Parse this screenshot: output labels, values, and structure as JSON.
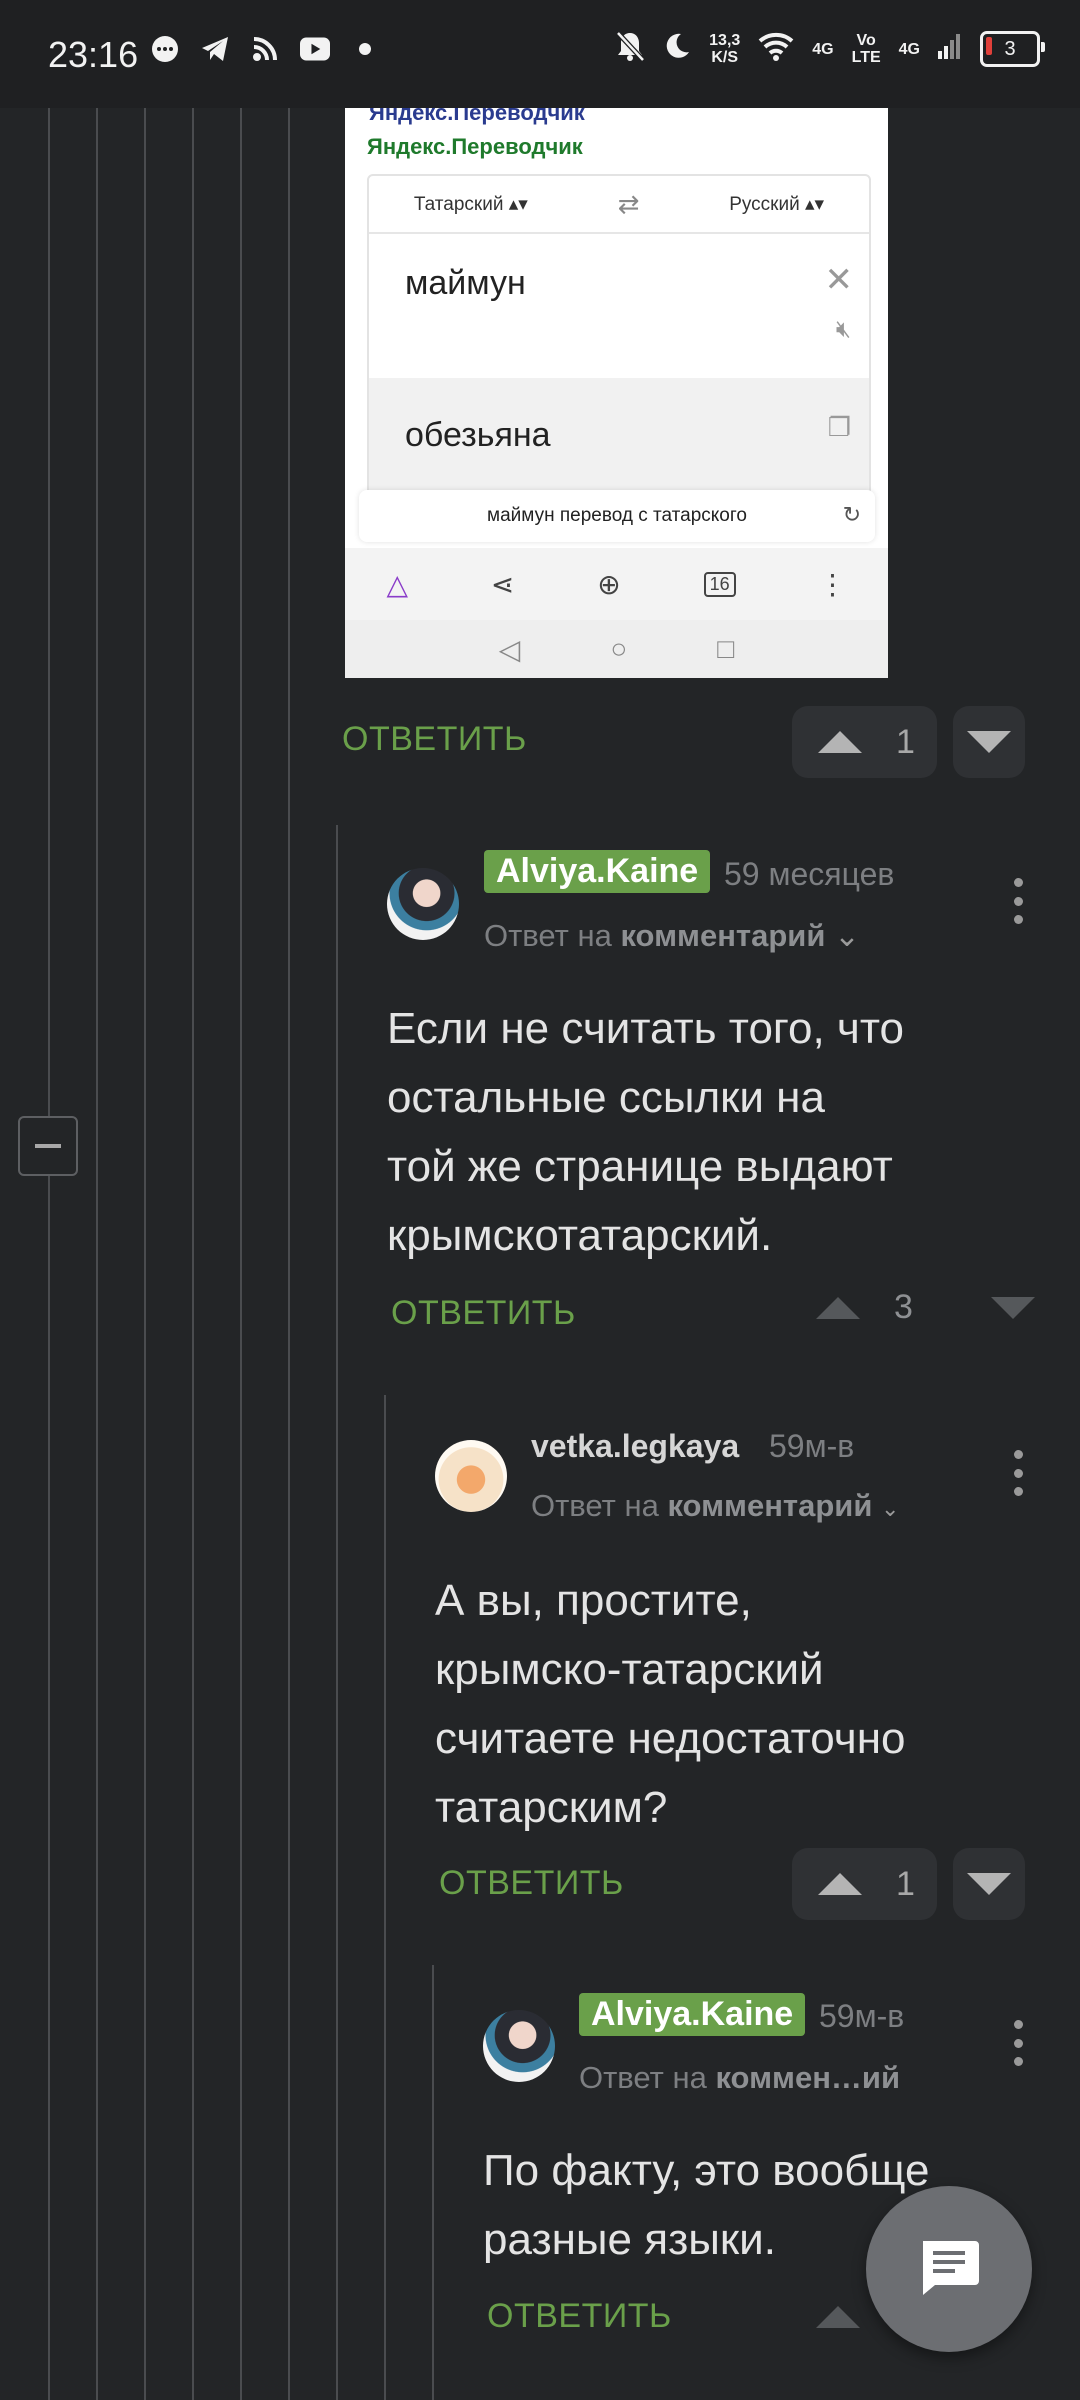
{
  "status_bar": {
    "time": "23:16",
    "net_speed_top": "13,3",
    "net_speed_bottom": "K/S",
    "lte_top": "Vo",
    "lte_bottom": "LTE",
    "signal1": "4G",
    "signal2": "4G",
    "battery": "3"
  },
  "image_screenshot": {
    "app_title_top": "Яндекс.Переводчик",
    "app_title": "Яндекс.Переводчик",
    "from_lang": "Татарский ▴▾",
    "to_lang": "Русский ▴▾",
    "source_text": "маймун",
    "translated_text": "обезьяна",
    "search_query": "маймун перевод с татарского",
    "tabs_count": "16"
  },
  "first_reply": {
    "reply_label": "ОТВЕТИТЬ",
    "votes": "1"
  },
  "comments": [
    {
      "username": "Alviya.Kaine",
      "time": "59 месяцев",
      "reply_prefix": "Ответ на",
      "reply_target": "комментарий",
      "text_lines": [
        "Если не считать того, что",
        "остальные ссылки на",
        "той же странице выдают",
        "крымскотатарский."
      ],
      "reply_label": "ОТВЕТИТЬ",
      "votes": "3"
    },
    {
      "username": "vetka.legkaya",
      "time": "59м-в",
      "reply_prefix": "Ответ на",
      "reply_target": "комментарий",
      "text_lines": [
        "А вы, простите,",
        "крымско-татарский",
        "считаете недостаточно",
        "татарским?"
      ],
      "reply_label": "ОТВЕТИТЬ",
      "votes": "1"
    },
    {
      "username": "Alviya.Kaine",
      "time": "59м-в",
      "reply_prefix": "Ответ на",
      "reply_target": "коммен…ий",
      "text_lines": [
        "По факту, это вообще",
        "разные языки."
      ],
      "reply_label": "ОТВЕТИТЬ"
    }
  ],
  "colors": {
    "background": "#232527",
    "accent_green": "#6aa04a",
    "text_primary": "#e4e4e4",
    "text_muted": "#7d7f82"
  },
  "icons": [
    "message-icon",
    "telegram-icon",
    "rss-icon",
    "youtube-icon",
    "dot-icon",
    "mute-icon",
    "moon-icon",
    "wifi-icon",
    "comment-fab-icon"
  ]
}
